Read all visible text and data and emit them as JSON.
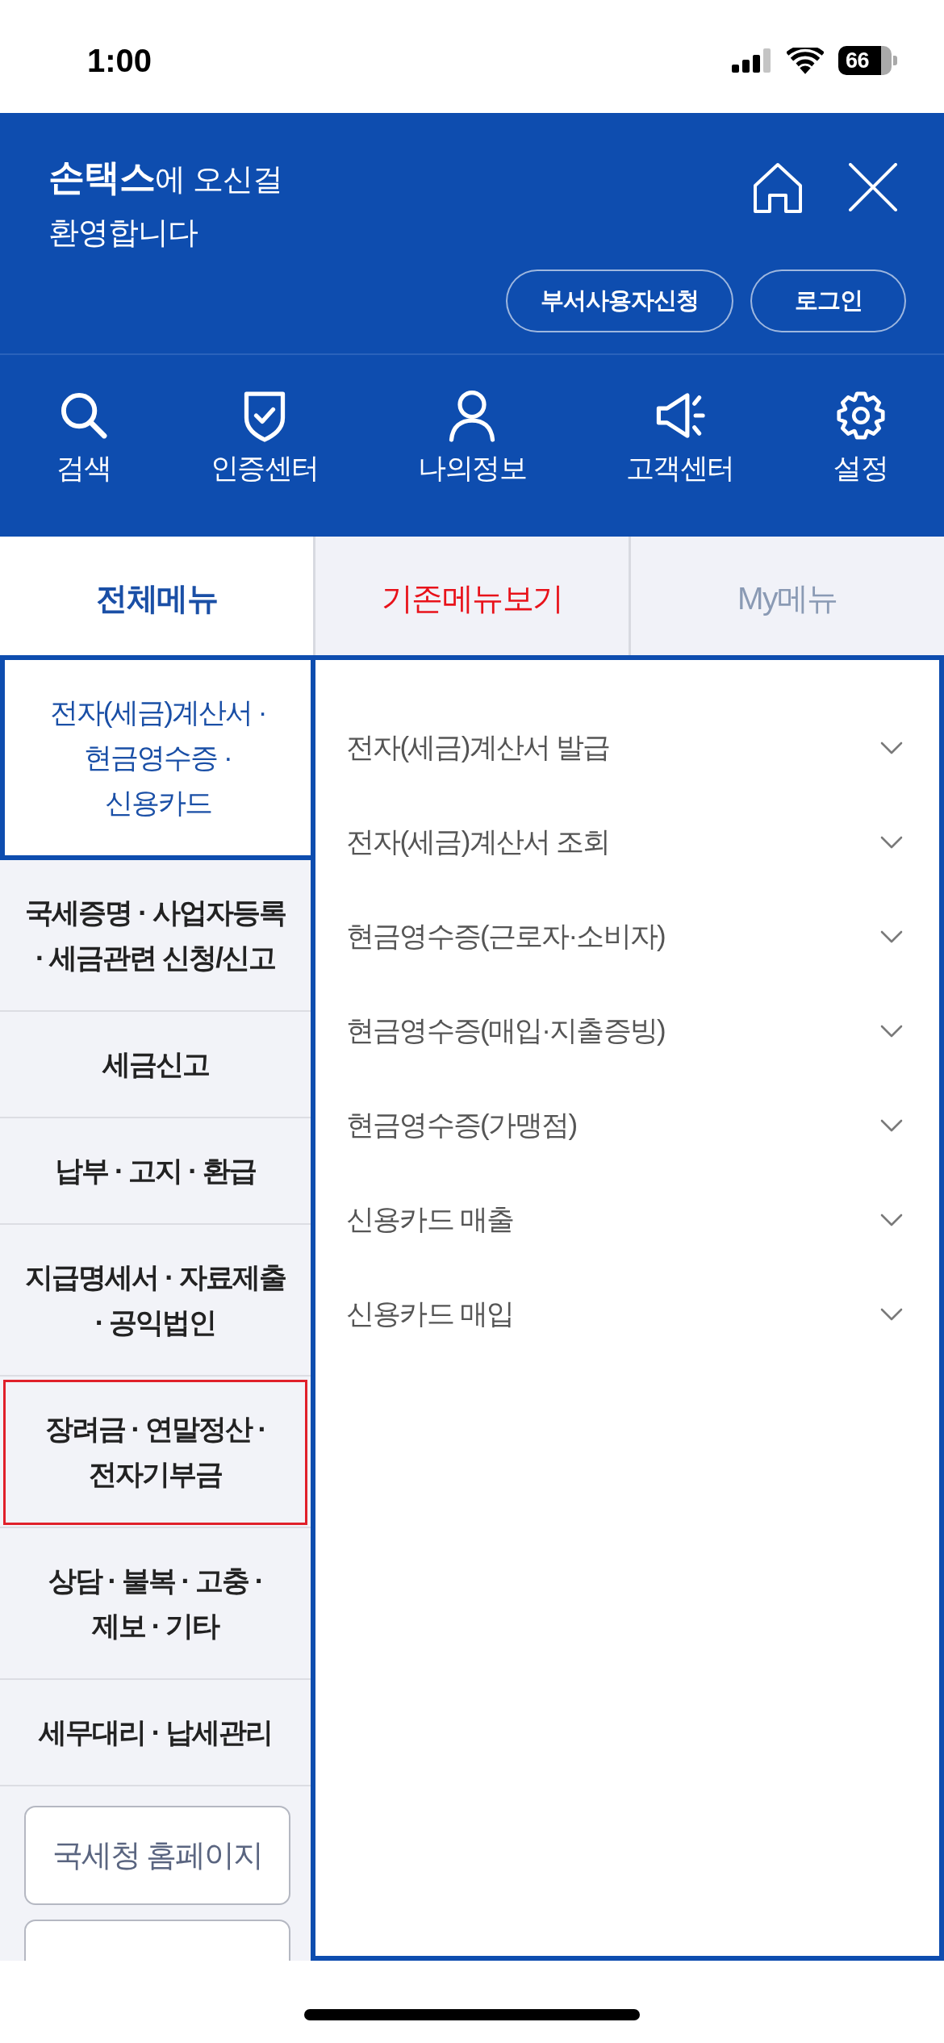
{
  "status_bar": {
    "time": "1:00",
    "battery": "66"
  },
  "header": {
    "greeting": "**손택스**에 오신걸\n환영합니다",
    "buttons": [
      {
        "label": "부서사용자신청"
      },
      {
        "label": "로그인"
      }
    ]
  },
  "quick_menu": [
    {
      "label": "검색"
    },
    {
      "label": "인증센터"
    },
    {
      "label": "나의정보"
    },
    {
      "label": "고객센터"
    },
    {
      "label": "설정"
    }
  ],
  "tabs": [
    {
      "label": "전체메뉴",
      "selected": true,
      "emphasized": false
    },
    {
      "label": "기존메뉴보기",
      "selected": false,
      "emphasized": true
    },
    {
      "label": "My메뉴",
      "selected": false,
      "emphasized": false
    }
  ],
  "categories": [
    {
      "label": "전자(세금)계산서 ·\n현금영수증 ·\n신용카드",
      "selected": true,
      "highlighted": false
    },
    {
      "label": "국세증명 · 사업자등록\n· 세금관련 신청/신고",
      "selected": false,
      "highlighted": false
    },
    {
      "label": "세금신고",
      "selected": false,
      "highlighted": false
    },
    {
      "label": "납부 · 고지 · 환급",
      "selected": false,
      "highlighted": false
    },
    {
      "label": "지급명세서 · 자료제출\n· 공익법인",
      "selected": false,
      "highlighted": false
    },
    {
      "label": "장려금 · 연말정산 ·\n전자기부금",
      "selected": false,
      "highlighted": true
    },
    {
      "label": "상담 · 불복 · 고충 ·\n제보 · 기타",
      "selected": false,
      "highlighted": false
    },
    {
      "label": "세무대리 · 납세관리",
      "selected": false,
      "highlighted": false
    }
  ],
  "links": [
    {
      "label": "국세청 홈페이지"
    }
  ],
  "submenu": [
    {
      "label": "전자(세금)계산서 발급",
      "expanded": false
    },
    {
      "label": "전자(세금)계산서 조회",
      "expanded": false
    },
    {
      "label": "현금영수증(근로자·소비자)",
      "expanded": false
    },
    {
      "label": "현금영수증(매입·지출증빙)",
      "expanded": false
    },
    {
      "label": "현금영수증(가맹점)",
      "expanded": false
    },
    {
      "label": "신용카드 매출",
      "expanded": false
    },
    {
      "label": "신용카드 매입",
      "expanded": false
    }
  ]
}
